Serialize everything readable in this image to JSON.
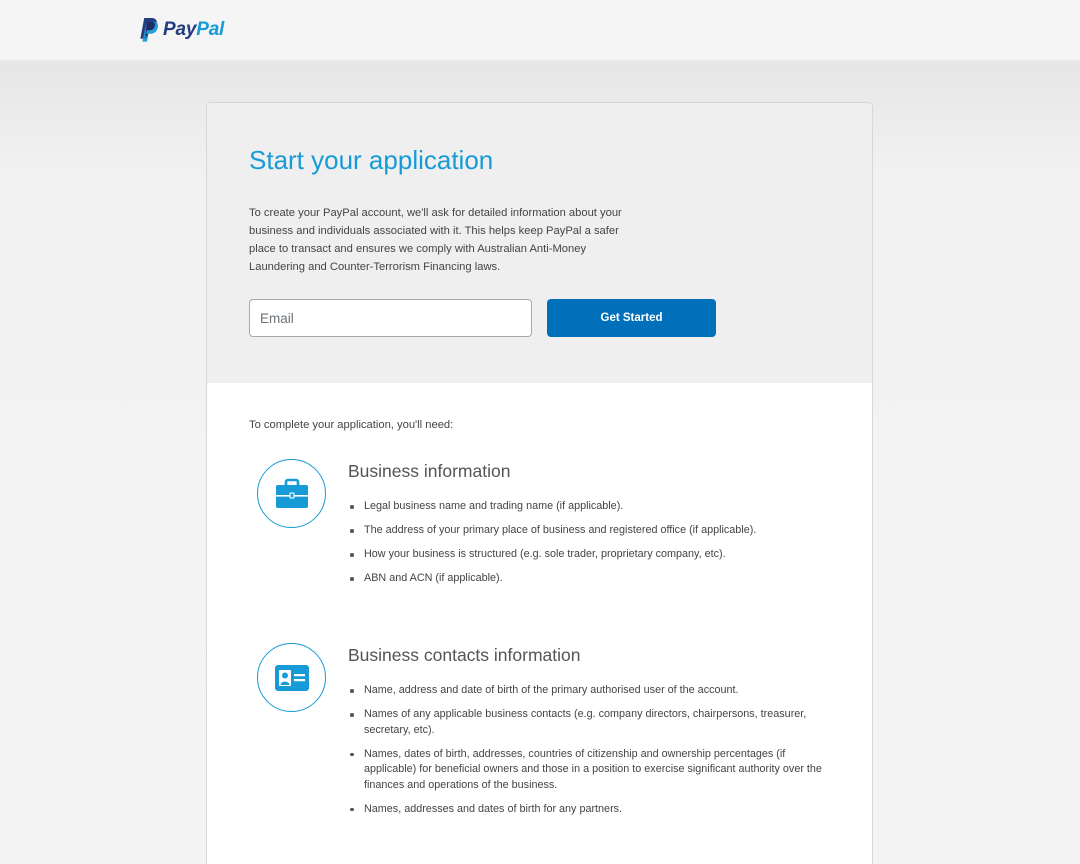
{
  "header": {
    "logo_text_pay": "Pay",
    "logo_text_pal": "Pal",
    "logo_icon": "paypal-p-icon"
  },
  "hero": {
    "title": "Start your application",
    "description": "To create your PayPal account, we'll ask for detailed information about your business and individuals associated with it. This helps keep PayPal a safer place to transact and ensures we comply with Australian Anti-Money Laundering and Counter-Terrorism Financing laws.",
    "email_placeholder": "Email",
    "email_value": "",
    "button_label": "Get Started"
  },
  "requirements": {
    "intro": "To complete your application, you'll need:",
    "sections": [
      {
        "icon": "briefcase-icon",
        "title": "Business information",
        "items": [
          "Legal business name and trading name (if applicable).",
          "The address of your primary place of business and registered office (if applicable).",
          "How your business is structured (e.g. sole trader, proprietary company, etc).",
          "ABN and ACN (if applicable)."
        ]
      },
      {
        "icon": "id-card-icon",
        "title": "Business contacts information",
        "items": [
          "Name, address and date of birth of the primary authorised user of the account.",
          "Names of any applicable business contacts (e.g. company directors, chairpersons, treasurer, secretary, etc).",
          "Names, dates of birth, addresses, countries of citizenship and ownership percentages (if applicable) for beneficial owners and those in a position to exercise significant authority over the finances and operations of the business.",
          "Names, addresses and dates of birth for any partners."
        ]
      }
    ]
  },
  "colors": {
    "brand_dark": "#253b80",
    "brand_light": "#179bd7",
    "button": "#0070ba"
  }
}
